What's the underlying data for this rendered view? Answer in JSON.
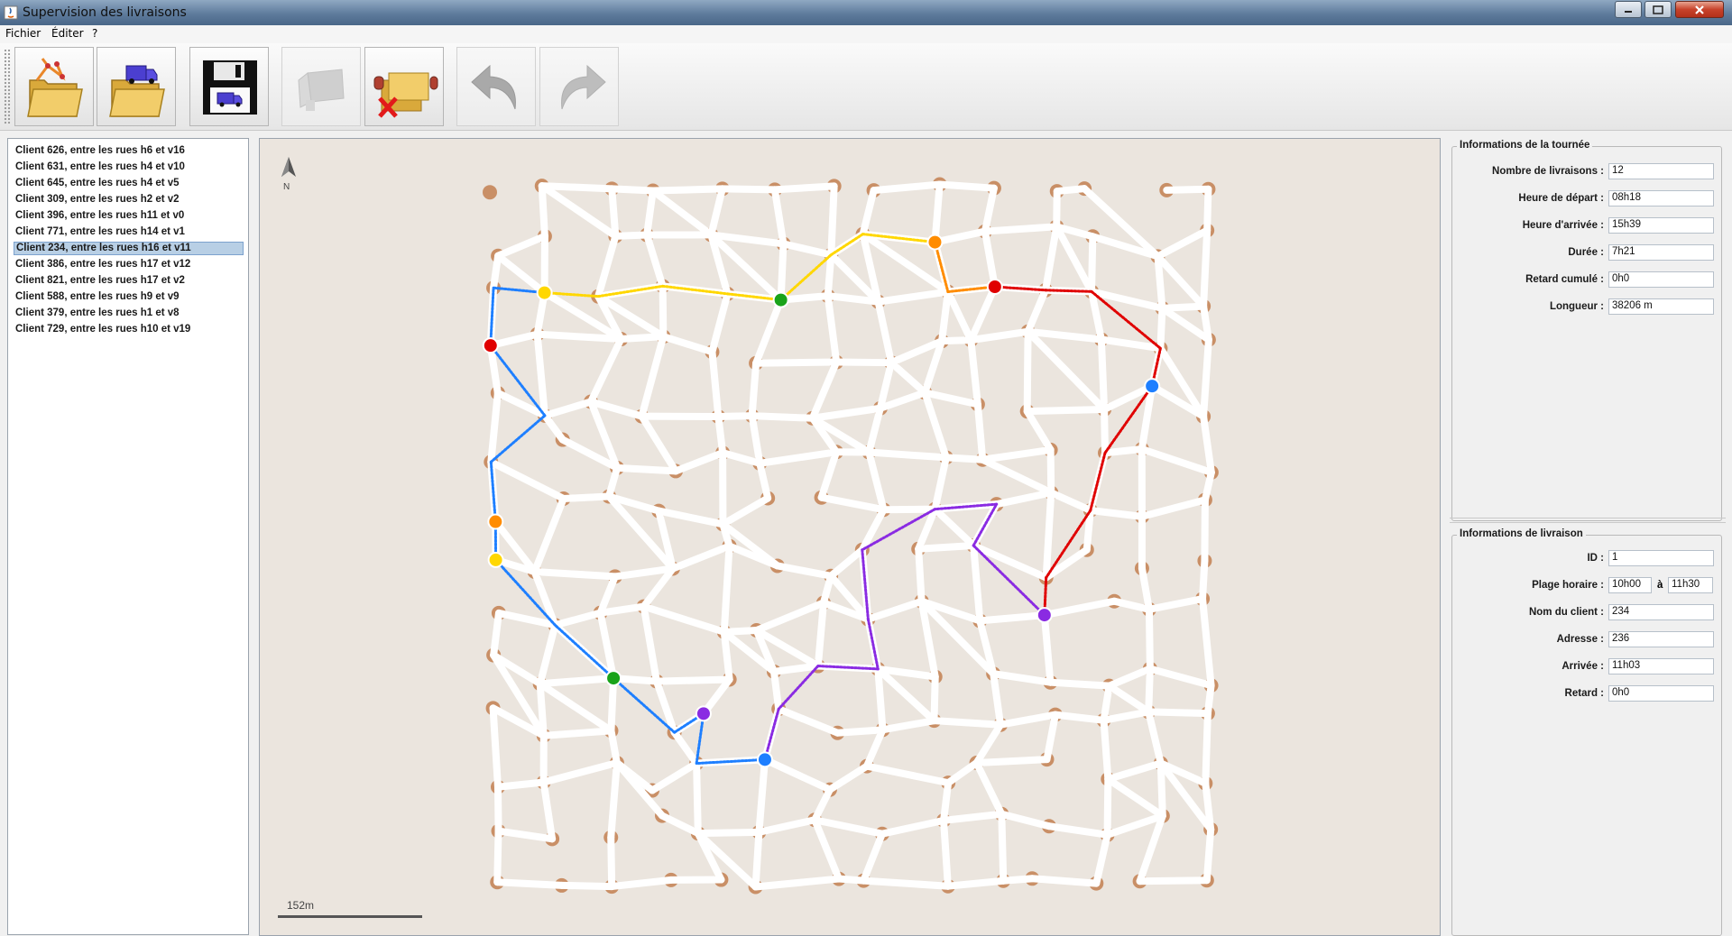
{
  "window": {
    "title": "Supervision des livraisons",
    "controls": [
      "minimize-icon",
      "maximize-icon",
      "close-icon"
    ]
  },
  "menu": {
    "items": [
      {
        "label": "Fichier"
      },
      {
        "label": "Éditer"
      },
      {
        "label": "?"
      }
    ]
  },
  "toolbar": {
    "buttons": [
      {
        "icon": "open-plan-icon",
        "enabled": true
      },
      {
        "icon": "open-deliveries-icon",
        "enabled": true
      },
      {
        "icon": "save-route-icon",
        "enabled": true
      },
      {
        "icon": "add-delivery-icon",
        "enabled": false
      },
      {
        "icon": "remove-delivery-icon",
        "enabled": true
      },
      {
        "icon": "undo-icon",
        "enabled": false
      },
      {
        "icon": "redo-icon",
        "enabled": false
      }
    ]
  },
  "client_list": {
    "selected_index": 6,
    "items": [
      "Client 626, entre les rues h6 et v16",
      "Client 631, entre les rues h4 et v10",
      "Client 645, entre les rues h4 et v5",
      "Client 309, entre les rues h2 et v2",
      "Client 396, entre les rues h11 et v0",
      "Client 771, entre les rues h14 et v1",
      "Client 234, entre les rues h16 et v11",
      "Client 386, entre les rues h17 et v12",
      "Client 821, entre les rues h17 et v2",
      "Client 588, entre les rues h9 et v9",
      "Client 379, entre les rues h1 et v8",
      "Client 729, entre les rues h10 et v19"
    ]
  },
  "map": {
    "north_label": "N",
    "scale_label": "152m",
    "colors": {
      "background": "#ebe5de",
      "street": "#ffffff",
      "node": "#c98f66",
      "route": [
        "#ffd700",
        "#ff8c00",
        "#e00000",
        "#8a2be2",
        "#1e7fff",
        "#19a319"
      ]
    }
  },
  "tour_info": {
    "legend": "Informations de la tournée",
    "fields": [
      {
        "label": "Nombre de livraisons :",
        "value": "12"
      },
      {
        "label": "Heure de départ :",
        "value": "08h18"
      },
      {
        "label": "Heure d'arrivée :",
        "value": "15h39"
      },
      {
        "label": "Durée :",
        "value": "7h21"
      },
      {
        "label": "Retard cumulé :",
        "value": "0h0"
      },
      {
        "label": "Longueur :",
        "value": "38206 m"
      }
    ]
  },
  "delivery_info": {
    "legend": "Informations de livraison",
    "id_label": "ID :",
    "id_value": "1",
    "window_label": "Plage horaire :",
    "window_start": "10h00",
    "window_sep": "à",
    "window_end": "11h30",
    "client_label": "Nom du client :",
    "client_value": "234",
    "address_label": "Adresse :",
    "address_value": "236",
    "arrival_label": "Arrivée :",
    "arrival_value": "11h03",
    "delay_label": "Retard :",
    "delay_value": "0h0"
  }
}
